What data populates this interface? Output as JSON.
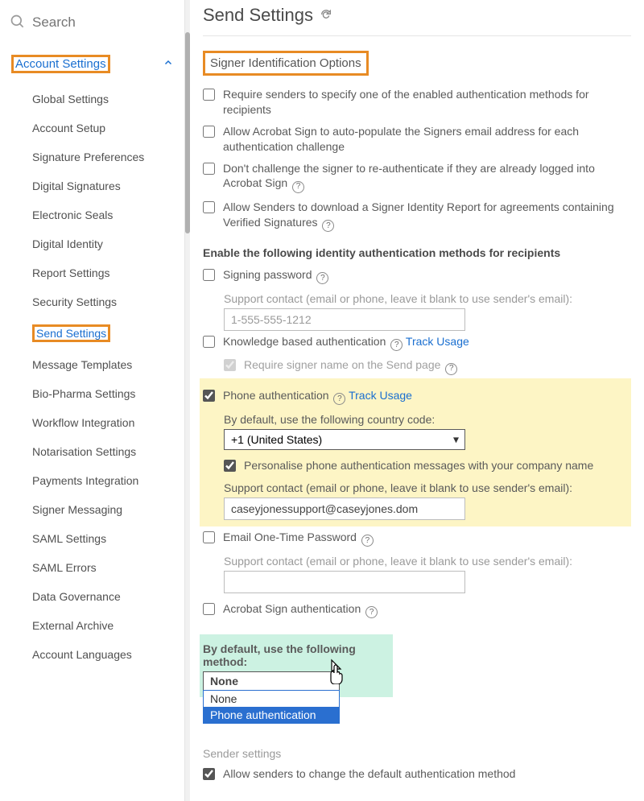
{
  "search": {
    "placeholder": "Search"
  },
  "sidebar": {
    "header": "Account Settings",
    "items": [
      {
        "label": "Global Settings"
      },
      {
        "label": "Account Setup"
      },
      {
        "label": "Signature Preferences"
      },
      {
        "label": "Digital Signatures"
      },
      {
        "label": "Electronic Seals"
      },
      {
        "label": "Digital Identity"
      },
      {
        "label": "Report Settings"
      },
      {
        "label": "Security Settings"
      },
      {
        "label": "Send Settings"
      },
      {
        "label": "Message Templates"
      },
      {
        "label": "Bio-Pharma Settings"
      },
      {
        "label": "Workflow Integration"
      },
      {
        "label": "Notarisation Settings"
      },
      {
        "label": "Payments Integration"
      },
      {
        "label": "Signer Messaging"
      },
      {
        "label": "SAML Settings"
      },
      {
        "label": "SAML Errors"
      },
      {
        "label": "Data Governance"
      },
      {
        "label": "External Archive"
      },
      {
        "label": "Account Languages"
      }
    ]
  },
  "page": {
    "title": "Send Settings",
    "section_heading": "Signer Identification Options",
    "top_options": [
      "Require senders to specify one of the enabled authentication methods for recipients",
      "Allow Acrobat Sign to auto-populate the Signers email address for each authentication challenge",
      "Don't challenge the signer to re-authenticate if they are already logged into Acrobat Sign",
      "Allow Senders to download a Signer Identity Report for agreements containing Verified Signatures"
    ],
    "enable_heading": "Enable the following identity authentication methods for recipients",
    "signing_password": {
      "label": "Signing password",
      "support_label": "Support contact (email or phone, leave it blank to use sender's email):",
      "support_value": "1-555-555-1212"
    },
    "kba": {
      "label": "Knowledge based authentication",
      "track": "Track Usage",
      "require_name": "Require signer name on the Send page"
    },
    "phone": {
      "label": "Phone authentication",
      "track": "Track Usage",
      "country_label": "By default, use the following country code:",
      "country_value": "+1 (United States)",
      "personalise": "Personalise phone authentication messages with your company name",
      "support_label": "Support contact (email or phone, leave it blank to use sender's email):",
      "support_value": "caseyjonessupport@caseyjones.dom"
    },
    "email_otp": {
      "label": "Email One-Time Password",
      "support_label": "Support contact (email or phone, leave it blank to use sender's email):"
    },
    "acrobat_auth": {
      "label": "Acrobat Sign authentication"
    },
    "default_method": {
      "label": "By default, use the following method:",
      "selected": "None",
      "options": [
        "None",
        "Phone authentication"
      ]
    },
    "sender_settings_heading": "Sender settings",
    "allow_change": "Allow senders to change the default authentication method"
  }
}
